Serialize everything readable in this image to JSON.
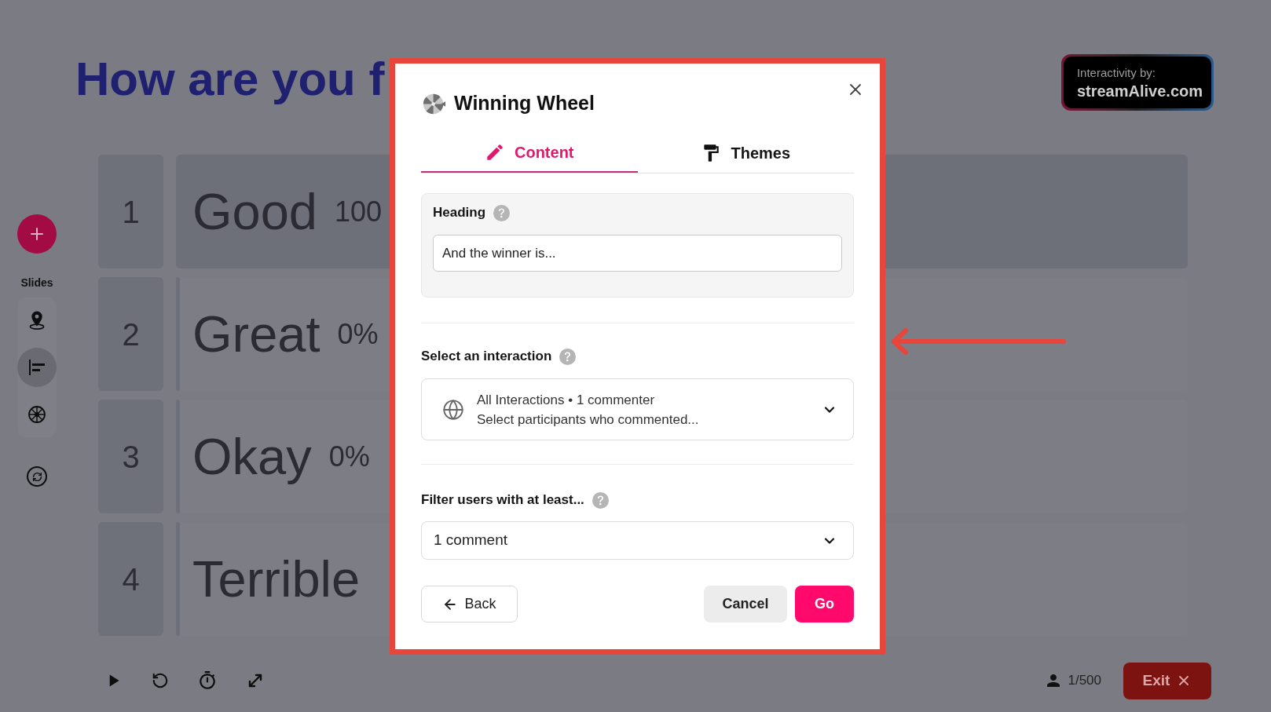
{
  "slide": {
    "title": "How are you f",
    "options": [
      {
        "number": "1",
        "label": "Good",
        "percent": "100",
        "level": 1
      },
      {
        "number": "2",
        "label": "Great",
        "percent": "0%",
        "level": 0
      },
      {
        "number": "3",
        "label": "Okay",
        "percent": "0%",
        "level": 0
      },
      {
        "number": "4",
        "label": "Terrible",
        "level": 0
      }
    ]
  },
  "badge": {
    "caption": "Interactivity by:",
    "brand": "streamAlive.com"
  },
  "sidebar": {
    "label": "Slides",
    "tools": [
      {
        "selected": false
      },
      {
        "selected": true
      },
      {
        "selected": false
      }
    ]
  },
  "footer": {
    "participants": "1/500",
    "exit": "Exit"
  },
  "modal": {
    "title": "Winning Wheel",
    "tabs": [
      {
        "label": "Content",
        "selected": true
      },
      {
        "label": "Themes",
        "selected": false
      }
    ],
    "heading": {
      "label": "Heading",
      "value": "And the winner is..."
    },
    "interaction": {
      "label": "Select an interaction",
      "summary": "All Interactions • 1 commenter",
      "hint": "Select participants who commented..."
    },
    "filter": {
      "label": "Filter users with at least...",
      "value": "1 comment"
    },
    "buttons": {
      "back": "Back",
      "cancel": "Cancel",
      "go": "Go"
    }
  }
}
